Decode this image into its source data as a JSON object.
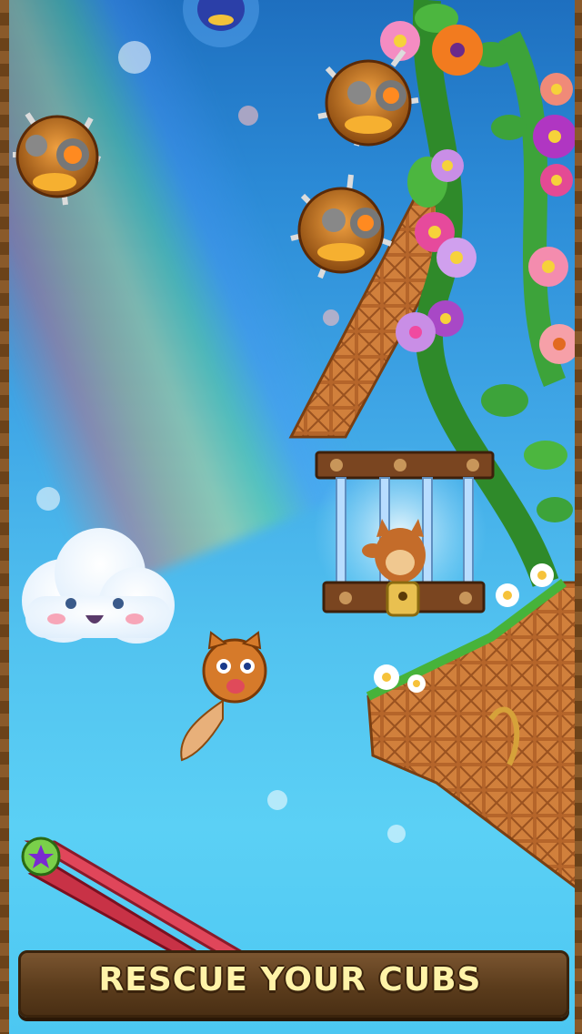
{
  "banner": {
    "text": "RESCUE YOUR CUBS"
  },
  "colors": {
    "sky_top": "#1e6fbf",
    "sky_bottom": "#4cc7f2",
    "wood": "#6b4219",
    "banner_text": "#fff3a8",
    "ramp": "#e0465a"
  },
  "icons": [
    "cloud-character",
    "fox-player",
    "caged-cub",
    "spiked-mine",
    "star-button",
    "flower",
    "golden-lock"
  ]
}
